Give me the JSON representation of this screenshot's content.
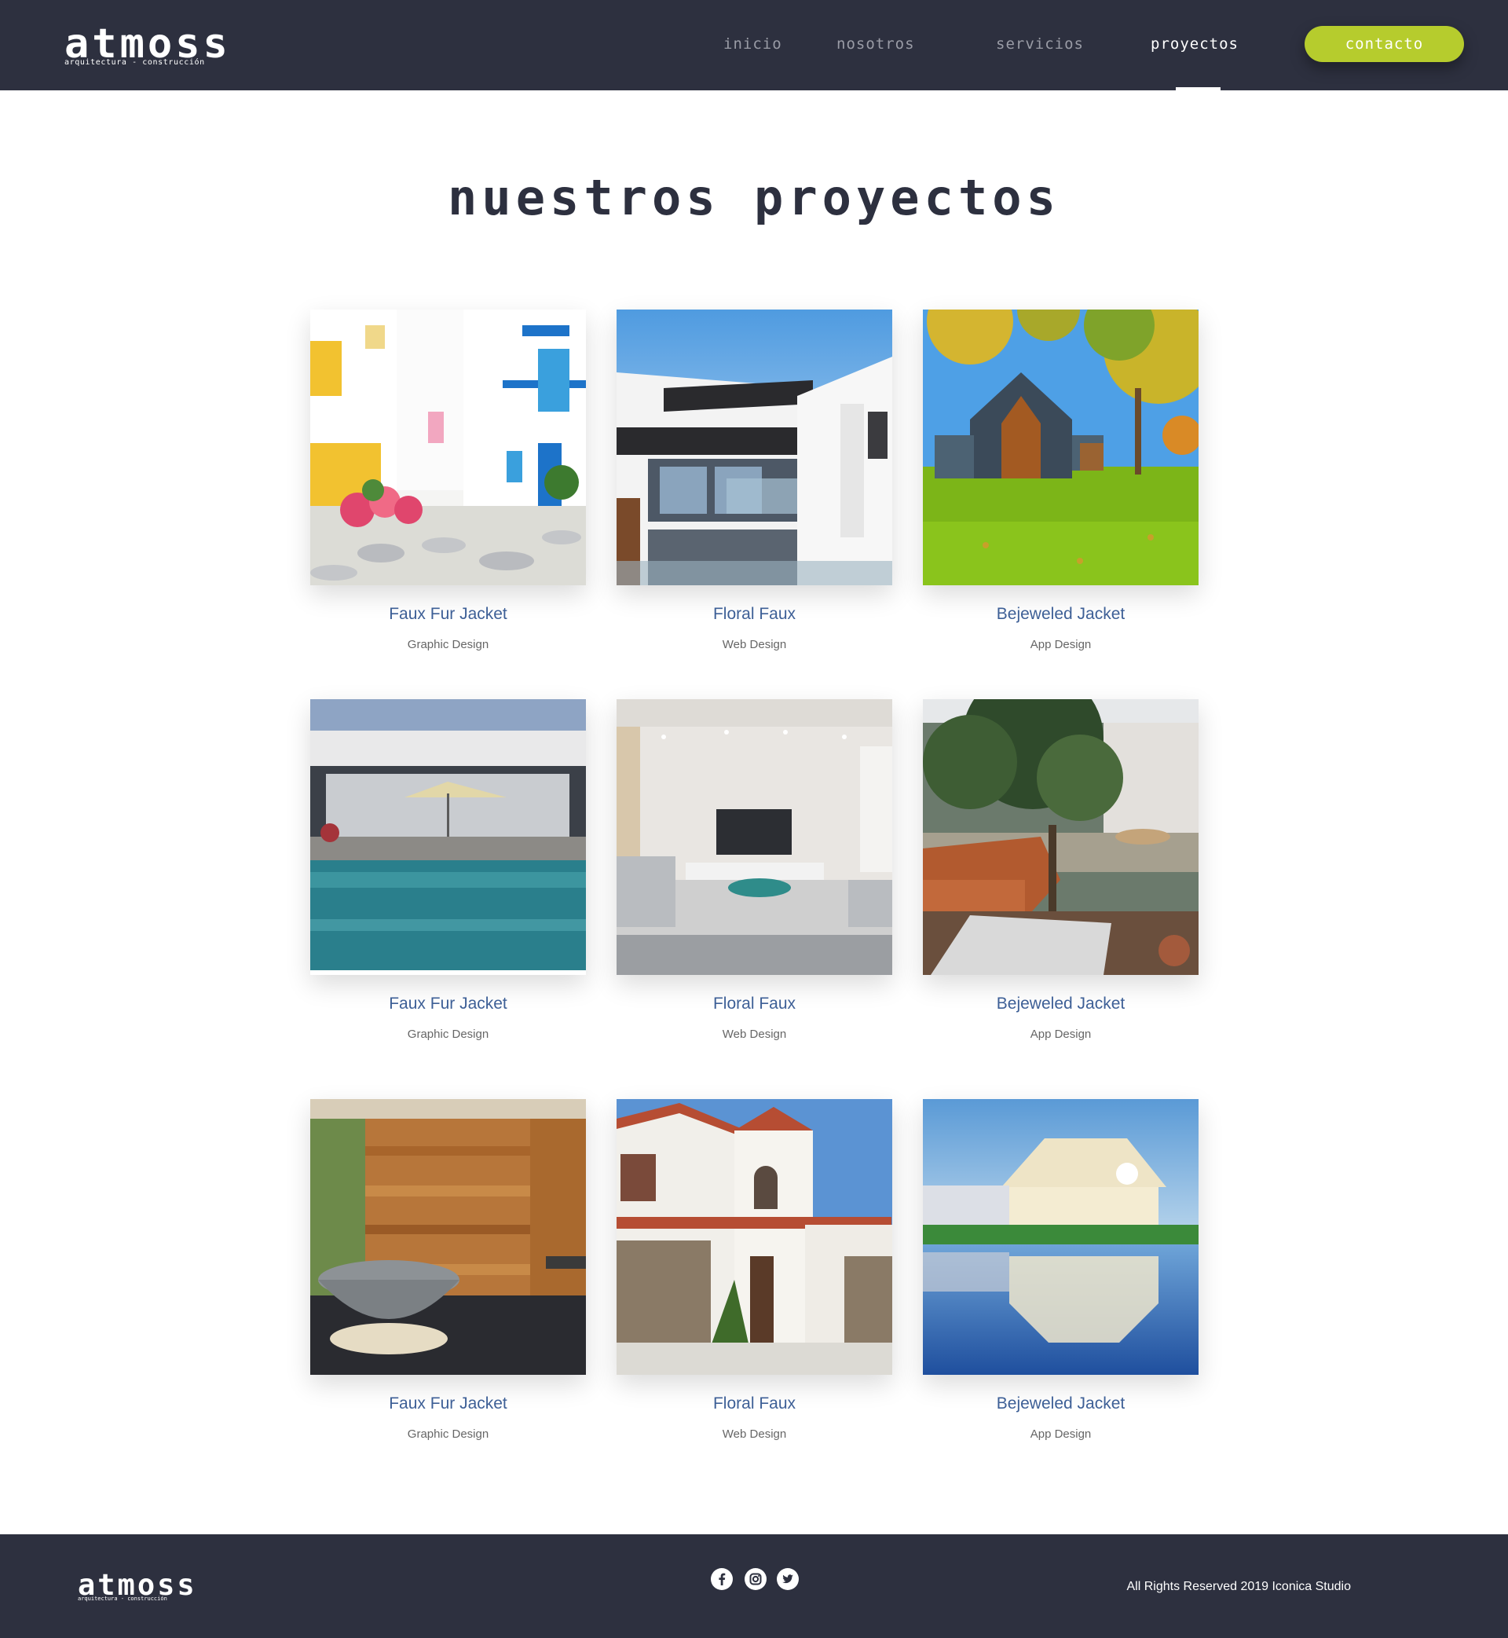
{
  "brand": {
    "name": "atmoss",
    "tagline": "arquitectura - construcción"
  },
  "nav": {
    "items": [
      {
        "label": "inicio"
      },
      {
        "label": "nosotros"
      },
      {
        "label": "servicios"
      },
      {
        "label": "proyectos",
        "active": true
      }
    ],
    "contact_label": "contacto"
  },
  "page": {
    "title": "nuestros proyectos"
  },
  "projects": [
    {
      "title": "Faux Fur Jacket",
      "category": "Graphic Design",
      "image": "white-blue-street-photo"
    },
    {
      "title": "Floral Faux",
      "category": "Web Design",
      "image": "modern-house-photo"
    },
    {
      "title": "Bejeweled Jacket",
      "category": "App Design",
      "image": "house-autumn-lawn-photo"
    },
    {
      "title": "Faux Fur Jacket",
      "category": "Graphic Design",
      "image": "pool-terrace-photo"
    },
    {
      "title": "Floral Faux",
      "category": "Web Design",
      "image": "living-room-photo"
    },
    {
      "title": "Bejeweled Jacket",
      "category": "App Design",
      "image": "patio-sofa-photo"
    },
    {
      "title": "Faux Fur Jacket",
      "category": "Graphic Design",
      "image": "stone-bathtub-photo"
    },
    {
      "title": "Floral Faux",
      "category": "Web Design",
      "image": "white-villa-photo"
    },
    {
      "title": "Bejeweled Jacket",
      "category": "App Design",
      "image": "lakeside-house-photo"
    }
  ],
  "footer": {
    "social": [
      "facebook-icon",
      "instagram-icon",
      "twitter-icon"
    ],
    "copyright": "All Rights Reserved 2019 Iconica Studio"
  },
  "colors": {
    "header_bg": "#2d303f",
    "accent": "#b6cc2d",
    "title_link": "#3d5f96"
  }
}
